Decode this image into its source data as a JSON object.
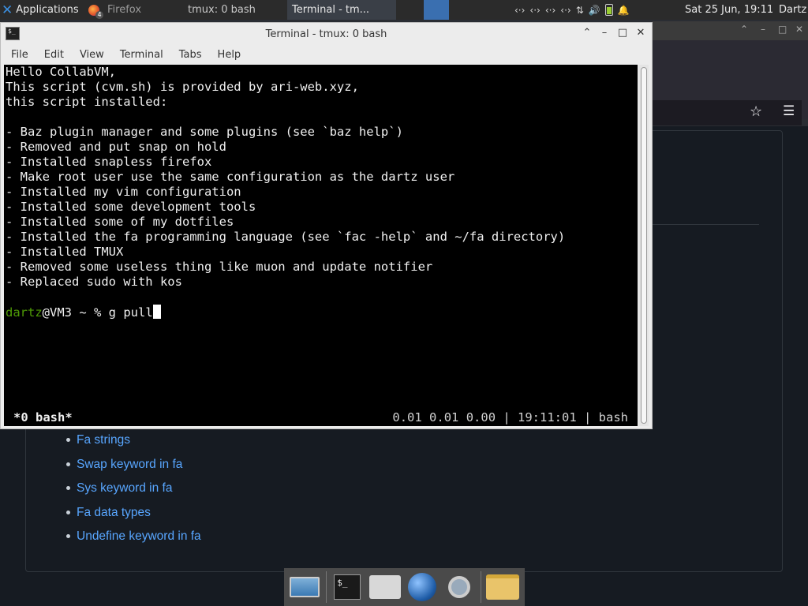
{
  "panel": {
    "applications_label": "Applications",
    "taskbar": [
      {
        "label": "Firefox",
        "badge": "4"
      },
      {
        "label": "tmux: 0 bash"
      },
      {
        "label": "Terminal - tm..."
      }
    ],
    "clock": "Sat 25 Jun, 19:11",
    "user": "Dartz"
  },
  "terminal": {
    "title": "Terminal - tmux: 0 bash",
    "menu": [
      "File",
      "Edit",
      "View",
      "Terminal",
      "Tabs",
      "Help"
    ],
    "lines": [
      "Hello CollabVM,",
      "This script (cvm.sh) is provided by ari-web.xyz,",
      "this script installed:",
      "",
      "- Baz plugin manager and some plugins (see `baz help`)",
      "- Removed and put snap on hold",
      "- Installed snapless firefox",
      "- Make root user use the same configuration as the dartz user",
      "- Installed my vim configuration",
      "- Installed some development tools",
      "- Installed some of my dotfiles",
      "- Installed the fa programming language (see `fac -help` and ~/fa directory)",
      "- Installed TMUX",
      "- Removed some useless thing like muon and update notifier",
      "- Replaced sudo with kos"
    ],
    "prompt_user": "dartz",
    "prompt_rest": "@VM3 ~ % g pull",
    "status_left": "*0 bash*",
    "status_right": "0.01 0.01 0.00 | 19:11:01 | bash"
  },
  "page": {
    "links": [
      "Fa strings",
      "Swap keyword in fa",
      "Sys keyword in fa",
      "Fa data types",
      "Undefine keyword in fa"
    ]
  },
  "colors": {
    "prompt_user": "#4e9a06",
    "link": "#58a6ff",
    "page_bg": "#161b22"
  }
}
